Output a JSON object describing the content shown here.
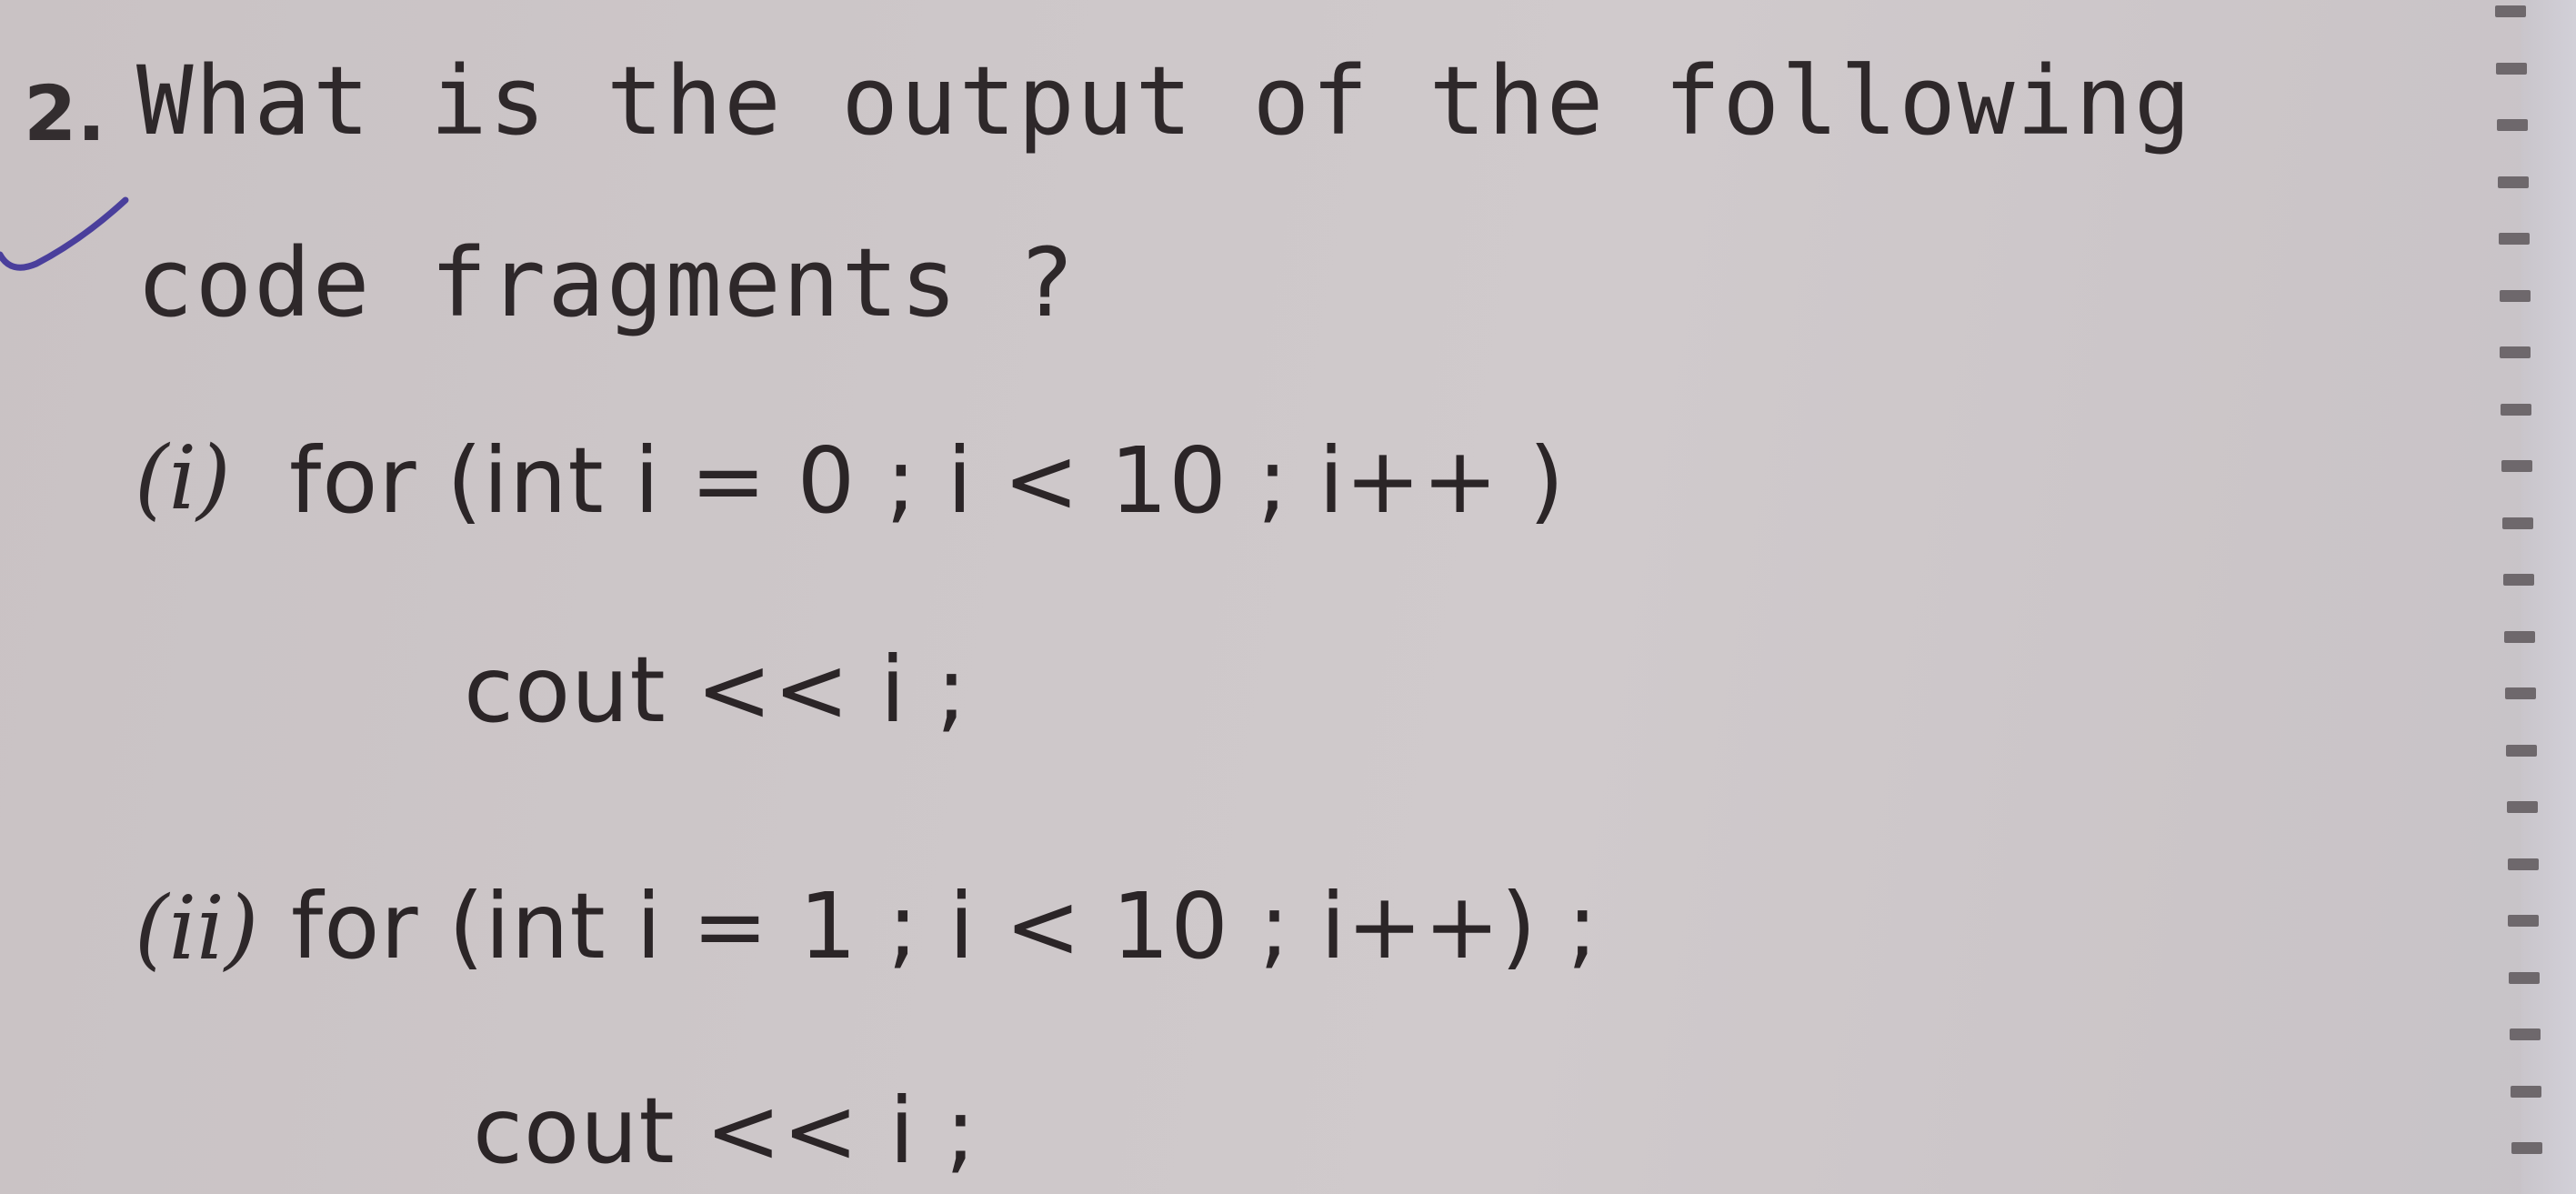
{
  "question": {
    "number": "2.",
    "line1": "What is the output of the following",
    "line2": "code fragments ?"
  },
  "parts": [
    {
      "label": "(i)",
      "code_line1": "for (int i = 0 ; i < 10 ; i++ )",
      "code_line2": "cout << i ;"
    },
    {
      "label": "(ii)",
      "code_line1": "for (int i = 1 ; i < 10 ; i++) ;",
      "code_line2": "cout << i ;"
    }
  ],
  "annotations": {
    "tick_mark": "check-mark",
    "tick_color": "#4a3f9c"
  },
  "icons": {
    "perforation": "perforated-edge"
  }
}
